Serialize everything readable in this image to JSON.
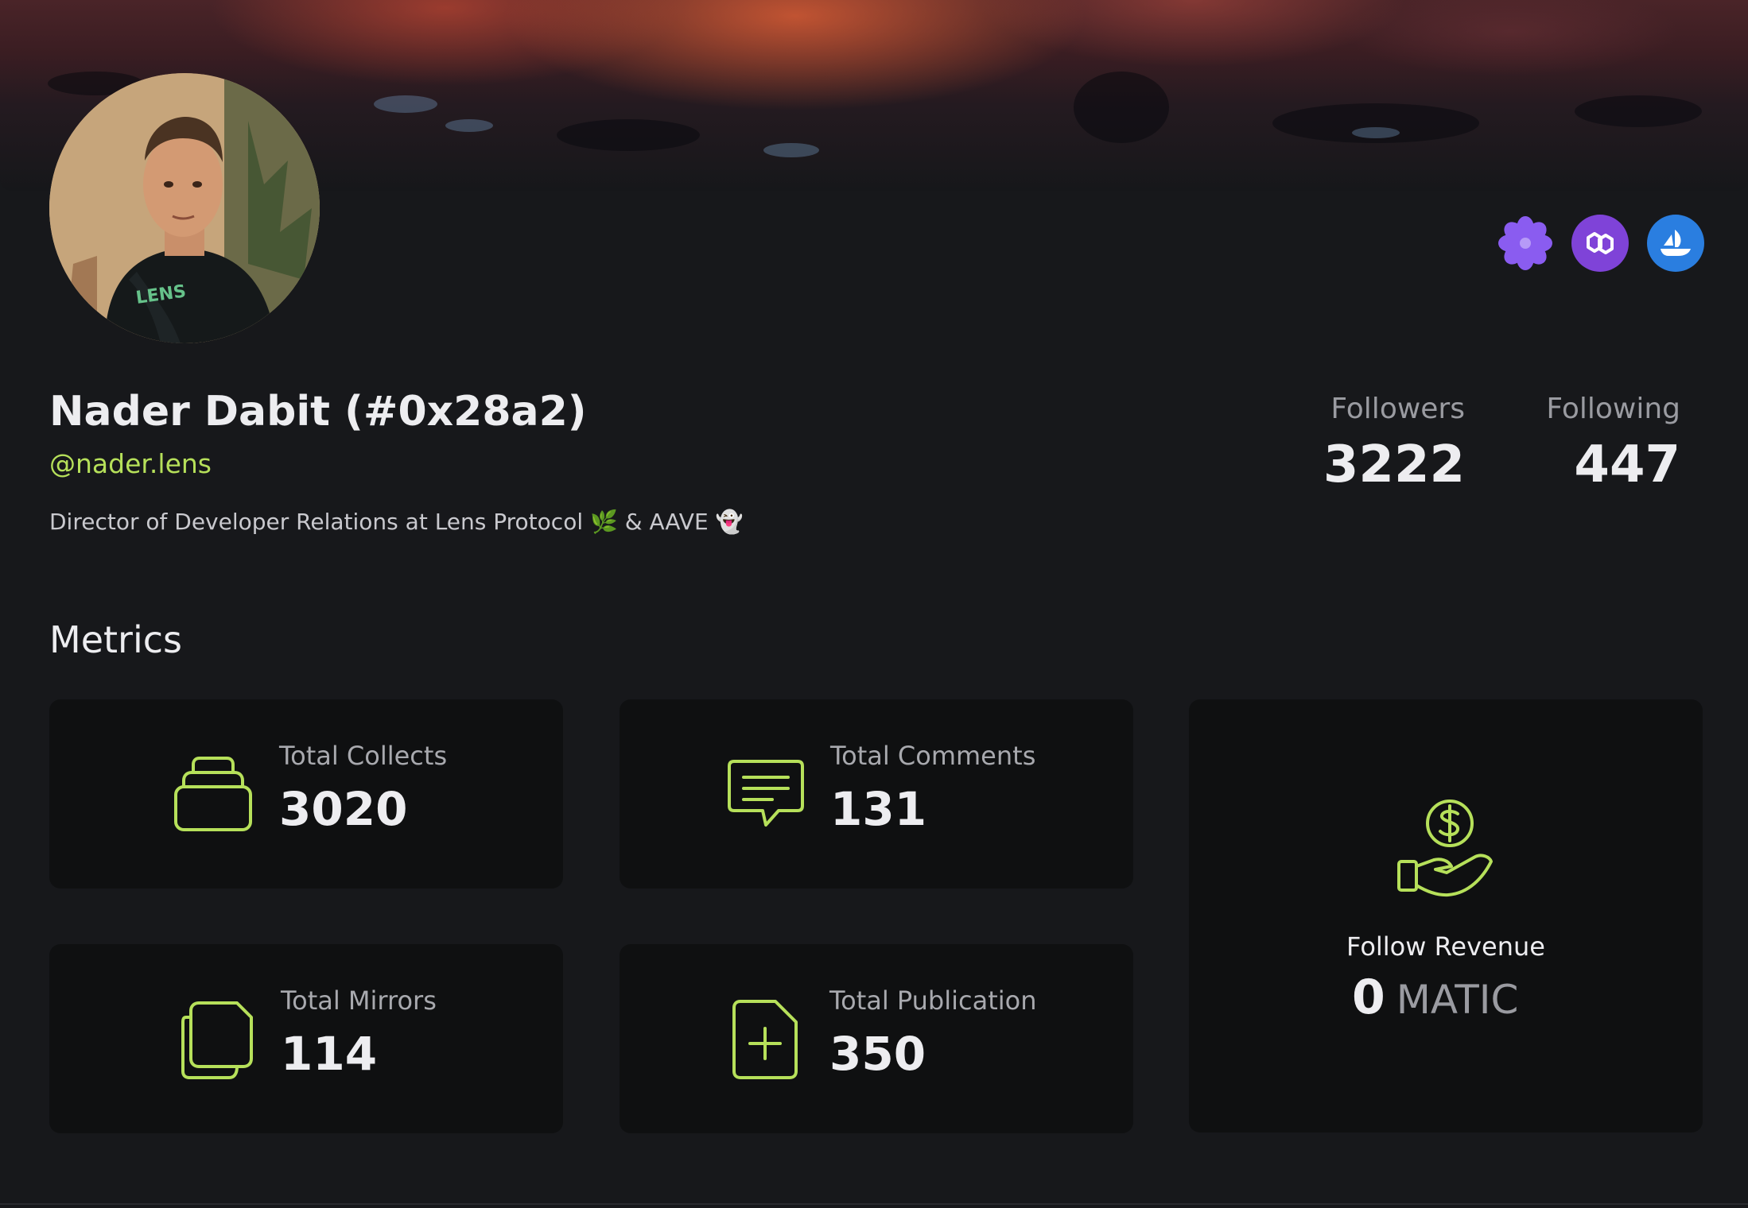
{
  "profile": {
    "name": "Nader Dabit (#0x28a2)",
    "handle": "@nader.lens",
    "bio": "Director of Developer Relations at Lens Protocol 🌿 & AAVE 👻",
    "followers_label": "Followers",
    "followers_value": "3222",
    "following_label": "Following",
    "following_value": "447"
  },
  "social_links": [
    {
      "icon": "lens-flower-icon",
      "color": "#8a5cf0"
    },
    {
      "icon": "polygon-icon",
      "color": "#7f43d8"
    },
    {
      "icon": "opensea-icon",
      "color": "#2a7ee0"
    }
  ],
  "metrics": {
    "title": "Metrics",
    "collects": {
      "label": "Total Collects",
      "value": "3020"
    },
    "comments": {
      "label": "Total Comments",
      "value": "131"
    },
    "mirrors": {
      "label": "Total Mirrors",
      "value": "114"
    },
    "publication": {
      "label": "Total Publication",
      "value": "350"
    },
    "revenue": {
      "label": "Follow Revenue",
      "value": "0",
      "unit": "MATIC"
    }
  },
  "colors": {
    "background": "#17181b",
    "card": "#0f1011",
    "accent": "#b6e05a",
    "text": "#ededf0",
    "muted": "#9a9ba1"
  }
}
